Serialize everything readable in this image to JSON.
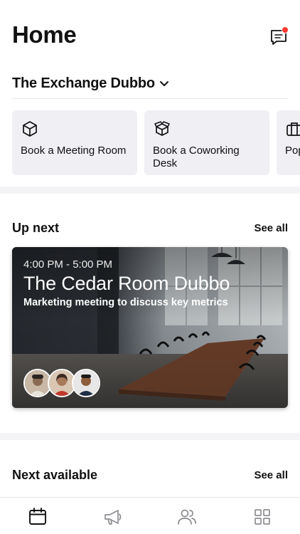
{
  "header": {
    "title": "Home",
    "messages_icon": "chat-bubble-icon",
    "notification_color": "#ff3b30"
  },
  "location": {
    "name": "The Exchange Dubbo",
    "icon": "chevron-down-icon"
  },
  "quick_actions": [
    {
      "label": "Book a Meeting Room",
      "icon": "cube-icon"
    },
    {
      "label": "Book a Coworking Desk",
      "icon": "open-box-icon"
    },
    {
      "label": "Pop",
      "icon": "briefcase-icon"
    }
  ],
  "up_next": {
    "title": "Up next",
    "see_all": "See all",
    "event": {
      "time": "4:00 PM - 5:00 PM",
      "room": "The Cedar Room Dubbo",
      "description": "Marketing meeting to discuss key metrics",
      "attendees": [
        "attendee-1",
        "attendee-2",
        "attendee-3"
      ]
    }
  },
  "next_available": {
    "title": "Next available",
    "see_all": "See all"
  },
  "tabbar": {
    "items": [
      {
        "icon": "calendar-icon",
        "active": true
      },
      {
        "icon": "megaphone-icon",
        "active": false
      },
      {
        "icon": "people-icon",
        "active": false
      },
      {
        "icon": "grid-icon",
        "active": false
      }
    ]
  },
  "colors": {
    "card_background": "#efeff4",
    "text": "#111111",
    "inactive_icon": "#8e8e93"
  }
}
